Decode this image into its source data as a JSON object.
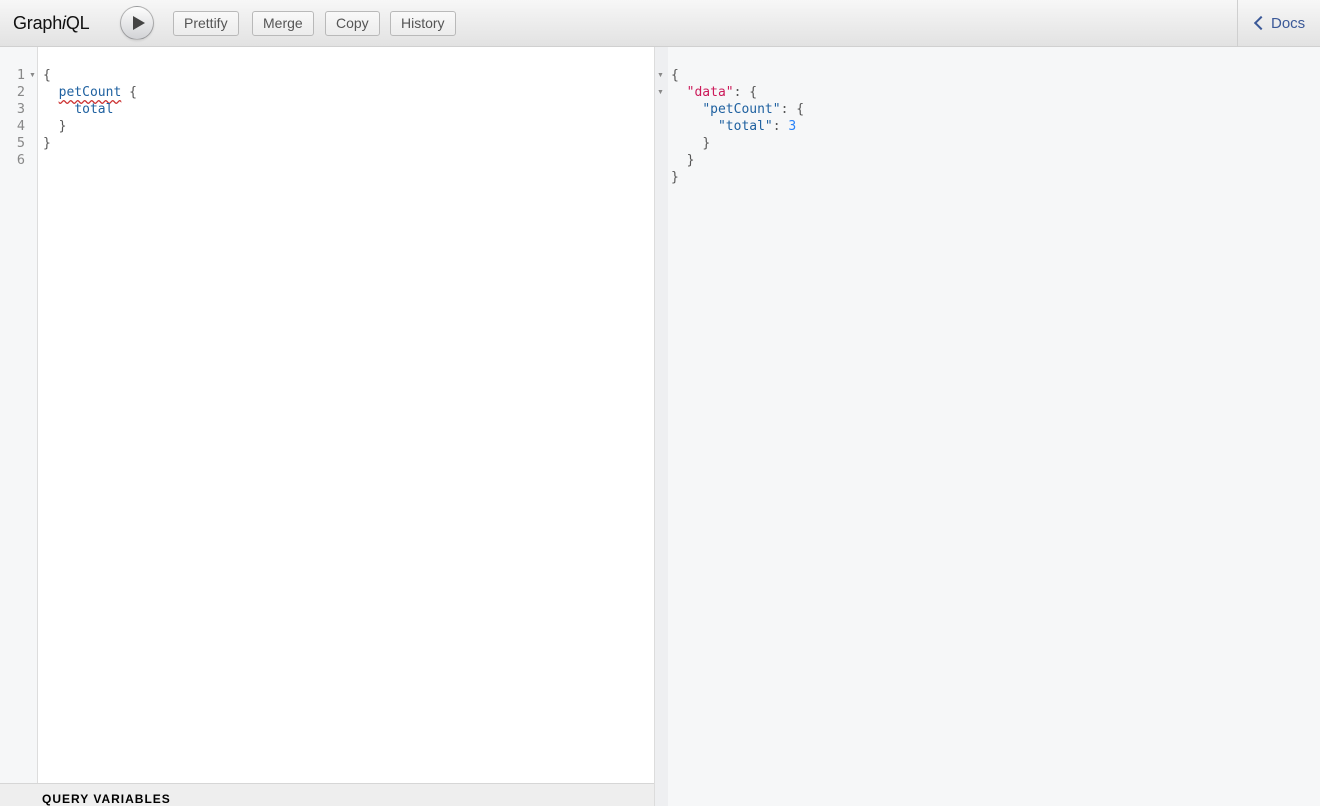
{
  "app": {
    "title_prefix": "Graph",
    "title_italic": "i",
    "title_suffix": "QL"
  },
  "toolbar": {
    "run_icon": "play-icon",
    "buttons": [
      {
        "label": "Prettify"
      },
      {
        "label": "Merge"
      },
      {
        "label": "Copy"
      },
      {
        "label": "History"
      }
    ],
    "docs_label": "Docs",
    "docs_icon": "chevron-left-icon"
  },
  "editor": {
    "line_numbers": [
      "1",
      "2",
      "3",
      "4",
      "5",
      "6"
    ],
    "lines": {
      "l1_brace": "{",
      "l2_field": "petCount",
      "l2_brace": "{",
      "l3_field": "total",
      "l4_brace": "}",
      "l5_brace": "}"
    }
  },
  "query_variables": {
    "title": "QUERY VARIABLES"
  },
  "result": {
    "open": "{",
    "data_key": "\"data\"",
    "petcount_key": "\"petCount\"",
    "total_key": "\"total\"",
    "total_value": "3",
    "colon_brace": ": {",
    "colon": ": ",
    "close_inner": "}",
    "close_data": "}",
    "close": "}"
  },
  "colors": {
    "docs_link": "#3b5998",
    "field": "#1f61a0",
    "string_key": "#cc1a5a",
    "number": "#2882f9"
  }
}
